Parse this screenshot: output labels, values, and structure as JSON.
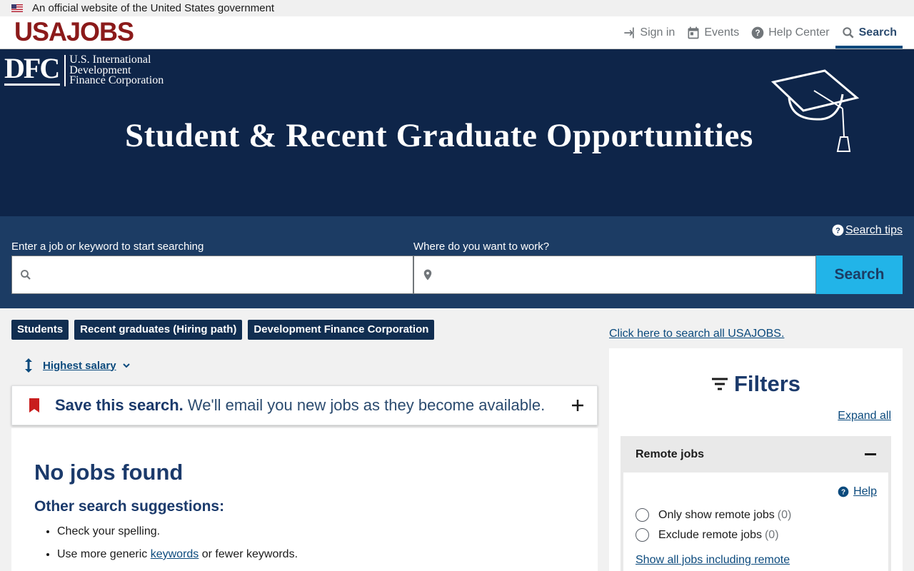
{
  "gov_banner": {
    "text": "An official website of the United States government"
  },
  "header": {
    "logo": "USAJOBS",
    "nav": [
      {
        "label": "Sign in",
        "icon": "sign-in-icon"
      },
      {
        "label": "Events",
        "icon": "calendar-icon"
      },
      {
        "label": "Help Center",
        "icon": "help-icon"
      },
      {
        "label": "Search",
        "icon": "search-icon",
        "active": true
      }
    ]
  },
  "hero": {
    "org_mark": "DFC",
    "org_name_1": "U.S. International",
    "org_name_2": "Development",
    "org_name_3": "Finance Corporation",
    "title": "Student & Recent Graduate Opportunities",
    "bg_color": "#0e2549"
  },
  "search": {
    "tips_label": "Search tips",
    "keyword_label": "Enter a job or keyword to start searching",
    "keyword_value": "",
    "location_label": "Where do you want to work?",
    "location_value": "",
    "button_label": "Search",
    "button_color": "#22b4e8"
  },
  "chips": [
    "Students",
    "Recent graduates (Hiring path)",
    "Development Finance Corporation"
  ],
  "sort": {
    "label": "Highest salary"
  },
  "save_search": {
    "bold": "Save this search.",
    "text": "We'll email you new jobs as they become available."
  },
  "results": {
    "heading": "No jobs found",
    "suggest_heading": "Other search suggestions:",
    "suggestion_1": "Check your spelling.",
    "suggestion_2_pre": "Use more generic ",
    "suggestion_2_link": "keywords",
    "suggestion_2_post": " or fewer keywords."
  },
  "sidebar": {
    "all_link": "Click here to search all USAJOBS.",
    "filters_title": "Filters",
    "expand_all": "Expand all",
    "remote": {
      "title": "Remote jobs",
      "help": "Help",
      "option_1": "Only show remote jobs",
      "option_1_count": "(0)",
      "option_2": "Exclude remote jobs",
      "option_2_count": "(0)",
      "show_all": "Show all jobs including remote"
    }
  }
}
